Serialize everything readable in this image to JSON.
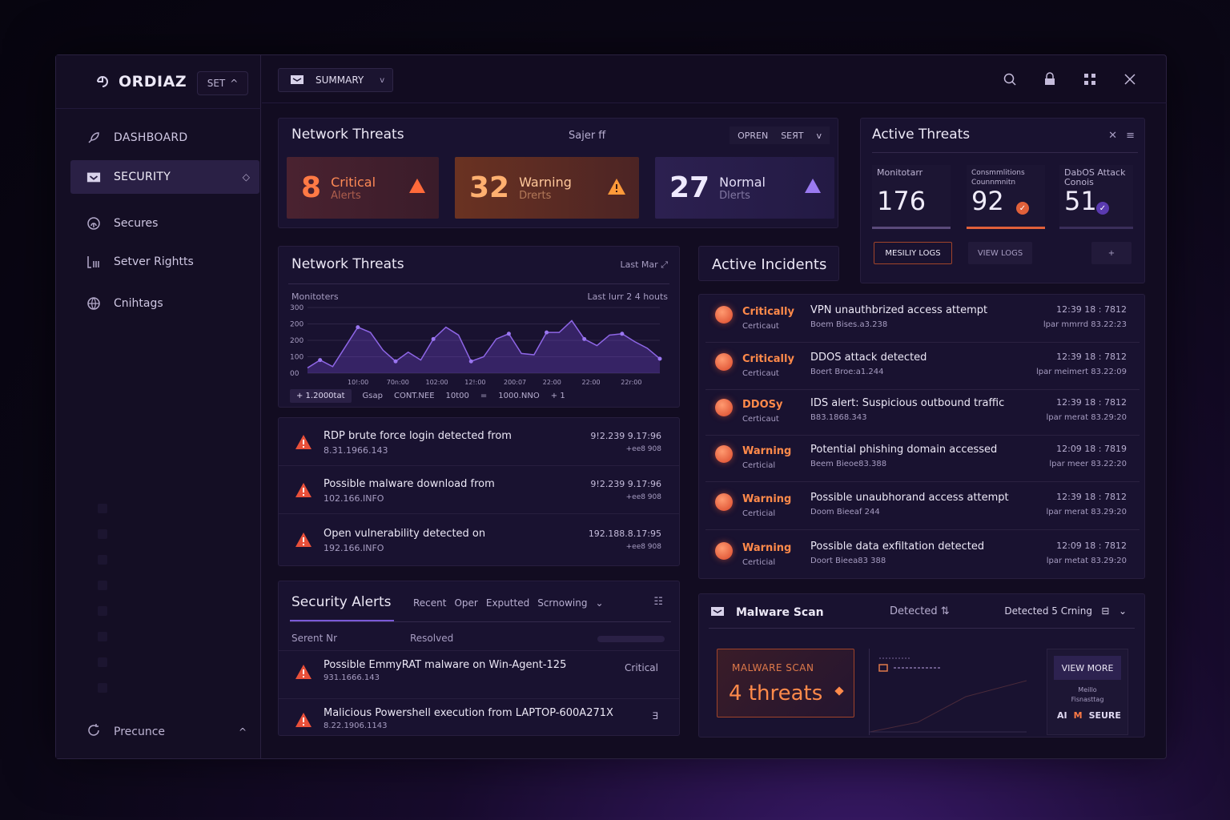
{
  "brand": {
    "name": "ORDIAZ",
    "set_label": "SET"
  },
  "sidebar": {
    "items": [
      {
        "label": "DASHBOARD",
        "icon": "rocket-icon"
      },
      {
        "label": "SECURITY",
        "icon": "inbox-icon"
      },
      {
        "label": "Secures",
        "icon": "fingerprint-icon"
      },
      {
        "label": "Setver Rightts",
        "icon": "server-icon"
      },
      {
        "label": "Cnihtags",
        "icon": "globe-icon"
      }
    ],
    "bottom_label": "Precunce"
  },
  "topbar": {
    "summary_label": "SUMMARY"
  },
  "network_threats_summary": {
    "title": "Network Threats",
    "subtitle": "Sajer ff",
    "ctrl_open": "OPREN",
    "ctrl_set": "SEЯT",
    "stats": [
      {
        "value": "8",
        "label": "Critical",
        "sublabel": "Alerts"
      },
      {
        "value": "32",
        "label": "Warning",
        "sublabel": "Drerts"
      },
      {
        "value": "27",
        "label": "Normal",
        "sublabel": "Dlerts"
      }
    ]
  },
  "active_threats": {
    "title": "Active Threats",
    "cards": [
      {
        "label": "Monitotarr",
        "value": "176"
      },
      {
        "label": "Consmmlitions Counnmnitn",
        "value": "92"
      },
      {
        "label": "DabOS Attack Conois",
        "value": "51"
      }
    ],
    "btn_logs": "MESILIY LOGS",
    "btn_view_logs": "VIEW LOGS",
    "btn_plus": "+"
  },
  "network_threats_chart": {
    "title": "Network Threats",
    "last_label": "Last Mar",
    "monitor_label": "Monitoters",
    "range_label": "Last lurr 2 4 houts",
    "footer": [
      "+ 1.2000tat",
      "Gsap",
      "CONT.NEE",
      "10t00",
      "=",
      "1000.NNO",
      "+ 1"
    ]
  },
  "chart_data": {
    "type": "area",
    "y_ticks": [
      "300",
      "200",
      "200",
      "100",
      "00"
    ],
    "x_ticks": [
      "10!:00",
      "70n:00",
      "102:00",
      "12!:00",
      "200:07",
      "22:00",
      "22:00",
      "22r:00"
    ],
    "values": [
      8,
      20,
      10,
      40,
      70,
      62,
      35,
      18,
      32,
      20,
      52,
      70,
      58,
      18,
      25,
      52,
      60,
      30,
      28,
      62,
      62,
      80,
      52,
      42,
      58,
      60,
      48,
      38,
      22
    ],
    "ylim": [
      0,
      100
    ]
  },
  "alert_list": [
    {
      "title": "RDP brute force login detected from",
      "ip": "8.31.1966.143",
      "r1": "9!2.239 9.17:96",
      "r2": "+ee8 908"
    },
    {
      "title": "Possible malware download from",
      "ip": "102.166.INFO",
      "r1": "9!2.239 9.17:96",
      "r2": "+ee8 908"
    },
    {
      "title": "Open vulnerability detected on",
      "ip": "192.166.INFO",
      "r1": "192.188.8.17:95",
      "r2": "+ee8 908"
    }
  ],
  "active_incidents": {
    "title": "Active Incidents",
    "rows": [
      {
        "sev": "Critically",
        "sub": "Certicaut",
        "desc": "VPN unauthbrized access attempt",
        "ip": "Boem Bises.a3.238",
        "time": "12:39 18 : 7812",
        "host": "lpar mmrrd 83.22:23"
      },
      {
        "sev": "Critically",
        "sub": "Certicaut",
        "desc": "DDOS attack detected",
        "ip": "Boert Broe:a1.244",
        "time": "12:39 18 : 7812",
        "host": "lpar meimert 83.22:09"
      },
      {
        "sev": "DDOSy",
        "sub": "Certicaut",
        "desc": "IDS alert: Suspicious outbound traffic",
        "ip": "B83.1868.343",
        "time": "12:39 18 : 7812",
        "host": "lpar merat 83.29:20"
      },
      {
        "sev": "Warning",
        "sub": "Certicial",
        "desc": "Potential phishing domain accessed",
        "ip": "Beem Bieoe83.388",
        "time": "12:09 18 : 7819",
        "host": "lpar meer 83.22:20"
      },
      {
        "sev": "Warning",
        "sub": "Certicial",
        "desc": "Possible unaubhorand access attempt",
        "ip": "Doom Bieeaf 244",
        "time": "12:39 18 : 7812",
        "host": "lpar merat 83.29:20"
      },
      {
        "sev": "Warning",
        "sub": "Certicial",
        "desc": "Possible data exfiltation detected",
        "ip": "Doort Bieea83 388",
        "time": "12:09 18 : 7812",
        "host": "lpar metat 83.29:20"
      }
    ]
  },
  "security_alerts": {
    "title": "Security Alerts",
    "tabs": [
      "Recent",
      "Oper",
      "Exputted",
      "Scrnowing"
    ],
    "col1": "Serent Nr",
    "col2": "Resolved",
    "rows": [
      {
        "title": "Possible EmmyRAT malware on Win-Agent-125",
        "ip": "931.1666.143",
        "right": "Critical"
      },
      {
        "title": "Malicious Powershell execution from LAPTOP-600A271X",
        "ip": "8.22.1906.1143",
        "right": "∃"
      }
    ]
  },
  "malware_scan": {
    "title": "Malware Scan",
    "detected": "Detected",
    "detected2": "Detected 5 Crning",
    "box_label": "MALWARE SCAN",
    "box_value": "4 threats",
    "view_more": "VIEW MORE",
    "small1": "Meillo",
    "small2": "Fisnasttag",
    "logos": [
      "AI",
      "M",
      "SEURE"
    ]
  },
  "colors": {
    "accent": "#7a5ad6",
    "critical": "#ff7a45",
    "warning": "#ffb070"
  }
}
